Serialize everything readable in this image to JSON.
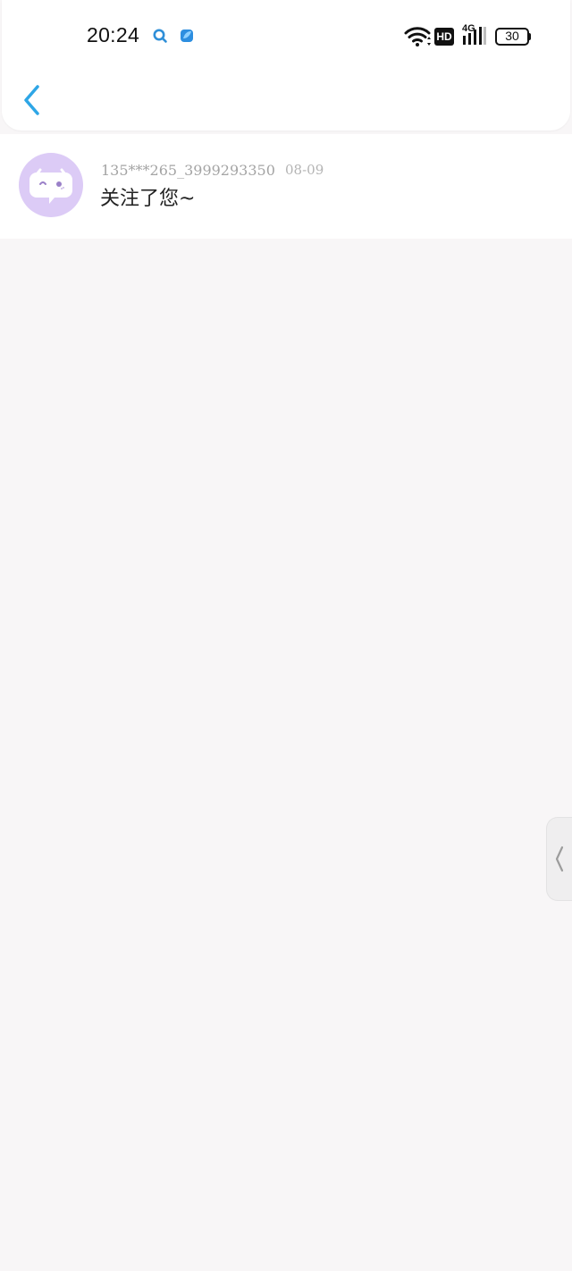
{
  "status_bar": {
    "time": "20:24",
    "network_type": "4G",
    "hd_label": "HD",
    "battery_level": "30",
    "icons": [
      "search-app-icon",
      "browser-app-icon",
      "wifi-icon",
      "hd-icon",
      "signal-icon",
      "battery-icon"
    ]
  },
  "header": {
    "back_icon": "chevron-left-icon",
    "accent_color": "#2ea6e6"
  },
  "notifications": [
    {
      "user_name": "135***265_3999293350",
      "date": "08-09",
      "message": "关注了您~",
      "avatar_icon": "chat-bubble-face-icon",
      "avatar_color": "#dccbf6"
    }
  ],
  "side_handle": {
    "icon": "chevron-left-icon"
  }
}
